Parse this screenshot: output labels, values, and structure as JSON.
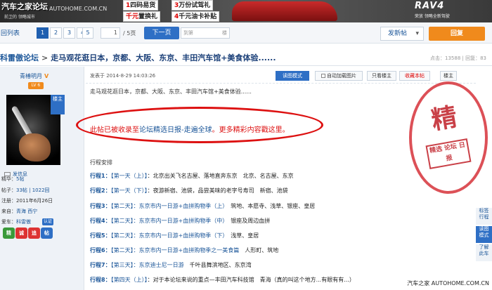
{
  "banner": {
    "brand": "汽车之家论坛",
    "brand_sub": "前卫的 领略城市",
    "watermark": "AUTOHOME.COM.CN",
    "promos": [
      {
        "num": "1",
        "text": "四码易货"
      },
      {
        "num": "3",
        "text": "万份试驾礼"
      },
      {
        "num": "千元",
        "text": "置换礼"
      },
      {
        "num": "4",
        "text": "千元油卡补贴"
      }
    ],
    "rav4": "RAV4",
    "rav4_sub": "荣放 领略全新驾驶"
  },
  "pagination": {
    "back_label": "回列表",
    "pages": [
      "1",
      "2",
      "3",
      "4",
      "5"
    ],
    "active_page": "1",
    "page_input": "1",
    "total": "/ 5页",
    "next_label": "下一页",
    "goto_label": "到第",
    "floor_label": "楼",
    "new_post_label": "发新帖",
    "reply_label": "回复"
  },
  "thread": {
    "crumb": "科雷傲论坛",
    "sep": ">",
    "title": "走马观花逛日本，京都、大阪、东京、丰田汽车馆+美食体验......",
    "stats": "点击：13588 | 回复：83"
  },
  "user": {
    "name": "青椿明月",
    "verified": "V",
    "level": "LV 6",
    "ribbon": "楼主",
    "send_msg": "发信息",
    "info": [
      {
        "label": "精华：",
        "value": "5帖",
        "link": true
      },
      {
        "label": "帖子：",
        "value": "33帖 | 1022回",
        "link": true
      },
      {
        "label": "注册：",
        "value": "2011年6月26日",
        "link": false
      },
      {
        "label": "来自：",
        "value": "青海 西宁",
        "link": true
      },
      {
        "label": "爱车：",
        "value": "科雷傲",
        "link": true
      }
    ],
    "cert_badge": "认证",
    "medals": [
      "精",
      "诚",
      "追",
      "帖"
    ]
  },
  "post": {
    "time": "发表于 2014-8-29 14:03:26",
    "btn_read": "读图模式",
    "btn_autoload": "自动加载图片",
    "btn_owner": "只看楼主",
    "btn_fav": "收藏本帖",
    "btn_floor": "楼主",
    "lead": "走马观花逛日本，京都、大阪、东京、丰田汽车馆+美食体验......",
    "note_red1": "此帖已被收录至",
    "note_blue": "论坛精选日报-走遍全球",
    "note_red2": "。更多精彩内容戳这里。",
    "schedule_title": "行程安排",
    "lines": [
      {
        "k": "行程1：",
        "d": "【第一天（上）】",
        "t": "：北京出关飞名古屋、落地直奔东京　北京、名古屋、东京"
      },
      {
        "k": "行程2：",
        "d": "【第一天（下）】",
        "t": "：夜游新宿、池袋，品尝美味的老字号寿司　新宿、池袋"
      },
      {
        "k": "行程3：",
        "d": "【第二天】：东京市内一日游+血拼购物季（上）",
        "t": "　筑地、本愿寺、浅草、银座、皇居"
      },
      {
        "k": "行程4：",
        "d": "【第二天】：东京市内一日游+血拼购物季（中）",
        "t": "　银座及周边血拼"
      },
      {
        "k": "行程5：",
        "d": "【第二天】：东京市内一日游+血拼购物季（下）",
        "t": "　浅草、皇居"
      },
      {
        "k": "行程6：",
        "d": "【第二天】：东京市内一日游+血拼购物季之一美食篇",
        "t": "　人形町、筑地"
      },
      {
        "k": "行程7：",
        "d": "【第三天】：东京迪士尼一日游",
        "t": "　千叶县舞滨地区、东京湾"
      },
      {
        "k": "行程8：",
        "d": "【第四天（上）】",
        "t": "：对于本论坛来说的重点—丰田汽车科技馆　青海（真的叫这个地方...有眼有有...）"
      }
    ],
    "stamp_big": "精",
    "stamp_small": "精选 论坛 日报"
  },
  "side_tabs": [
    "标签\n行程",
    "读图\n模式",
    "了解\n此车"
  ],
  "footer_watermark": "汽车之家 AUTOHOME.COM.CN"
}
